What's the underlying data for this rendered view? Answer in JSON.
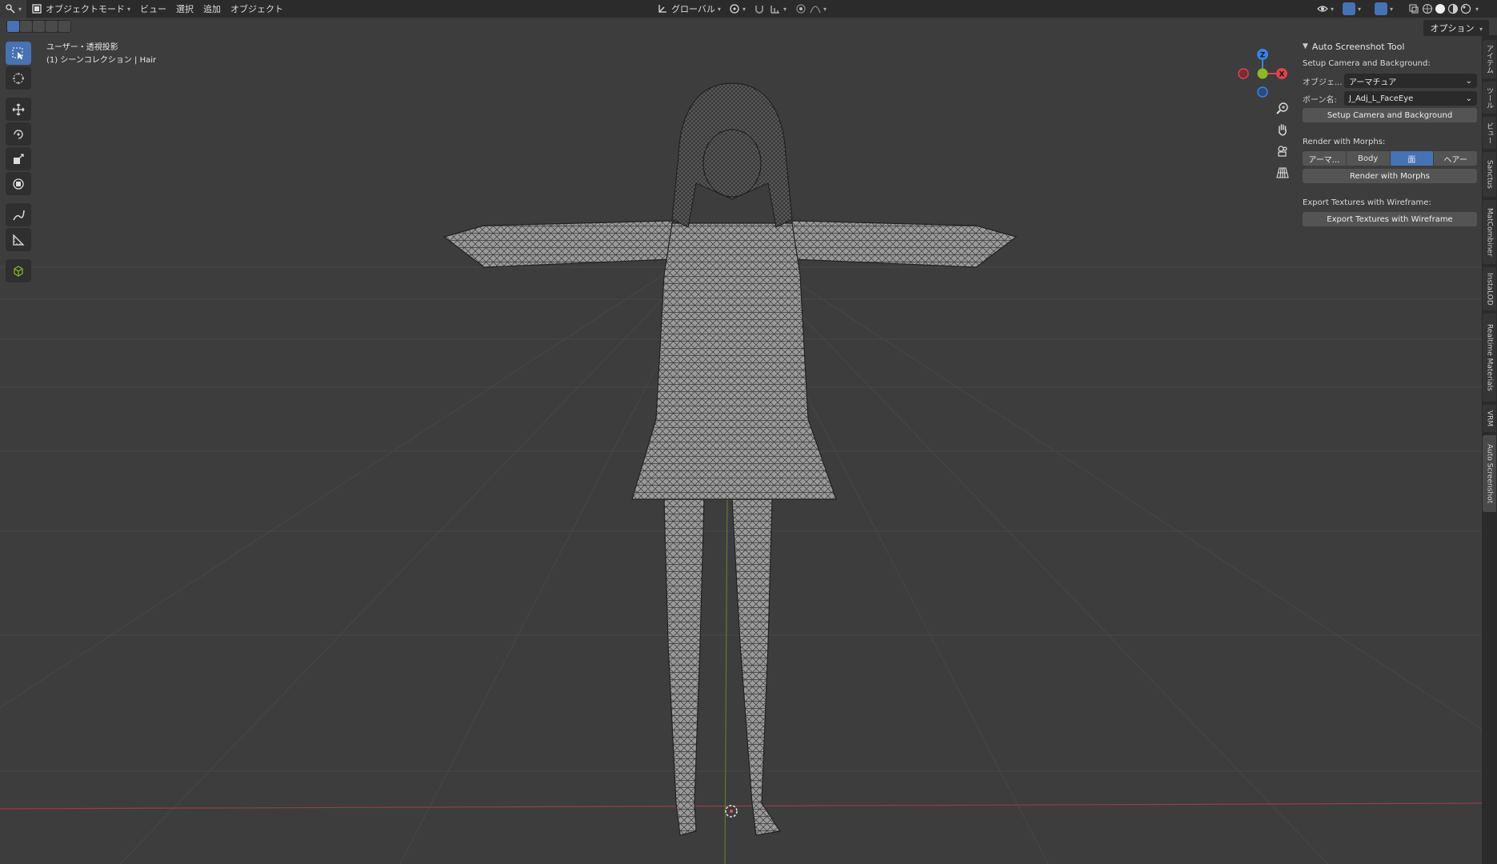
{
  "header": {
    "editor_type_icon": "editor-type-icon",
    "mode": "オブジェクトモード",
    "menus": [
      "ビュー",
      "選択",
      "追加",
      "オブジェクト"
    ],
    "transform_orientation": "グローバル",
    "options_label": "オプション"
  },
  "viewport": {
    "view_name": "ユーザー・透視投影",
    "collection_info": "(1) シーンコレクション | Hair",
    "gizmo_axes": {
      "x": "X",
      "y": "Y",
      "z": "Z"
    },
    "axis_colors": {
      "x": "#e0414d",
      "y": "#8ab827",
      "z": "#3a83e3"
    }
  },
  "tools": [
    "tweak-select-icon",
    "cursor-icon",
    "move-icon",
    "rotate-icon",
    "scale-icon",
    "transform-icon",
    "annotate-icon",
    "measure-icon",
    "add-cube-icon"
  ],
  "npanel": {
    "title": "Auto Screenshot Tool",
    "camera_section": "Setup Camera and Background:",
    "object_label": "オブジェ...",
    "object_value": "アーマチュア",
    "bone_label": "ボーン名:",
    "bone_value": "J_Adj_L_FaceEye",
    "setup_button": "Setup Camera and Background",
    "morph_section": "Render with Morphs:",
    "morph_options": [
      "アーマ...",
      "Body",
      "面",
      "ヘアー"
    ],
    "morph_selected": 2,
    "render_button": "Render with Morphs",
    "export_section": "Export Textures with Wireframe:",
    "export_button": "Export Textures with Wireframe"
  },
  "sidebar_tabs": [
    "アイテム",
    "ツール",
    "ビュー",
    "Sanctus",
    "MatCombiner",
    "InstaLOD",
    "Realtime Materials",
    "VRM",
    "Auto Screenshot"
  ],
  "active_tab": "Auto Screenshot",
  "colors": {
    "accent": "#4772b3",
    "background": "#3d3d3d",
    "header": "#2b2b2b"
  }
}
